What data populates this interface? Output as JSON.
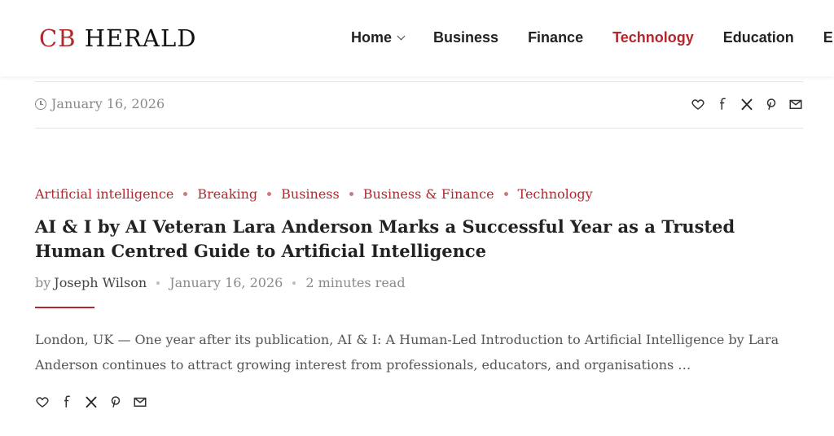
{
  "header": {
    "logo": {
      "prefix": "CB",
      "name": "HERALD"
    },
    "nav": [
      {
        "label": "Home",
        "has_dropdown": true,
        "active": false
      },
      {
        "label": "Business",
        "active": false
      },
      {
        "label": "Finance",
        "active": false
      },
      {
        "label": "Technology",
        "active": true
      },
      {
        "label": "Education",
        "active": false
      },
      {
        "label": "Ente",
        "active": false
      }
    ]
  },
  "top_meta": {
    "date": "January 16, 2026",
    "share_icons": [
      "heart-icon",
      "facebook-icon",
      "x-icon",
      "pinterest-icon",
      "mail-icon"
    ]
  },
  "article": {
    "categories": [
      "Artificial intelligence",
      "Breaking",
      "Business",
      "Business & Finance",
      "Technology"
    ],
    "title": "AI & I by AI Veteran Lara Anderson Marks a Successful Year as a Trusted Human Centred Guide to Artificial Intelligence",
    "by_prefix": "by",
    "author": "Joseph Wilson",
    "date": "January 16, 2026",
    "read_time": "2 minutes read",
    "excerpt": "London, UK — One year after its publication, AI & I: A Human-Led Introduction to Artificial Intelligence by Lara Anderson continues to attract growing interest from professionals, educators, and organisations …",
    "share_icons": [
      "heart-icon",
      "facebook-icon",
      "x-icon",
      "pinterest-icon",
      "mail-icon"
    ]
  },
  "colors": {
    "accent": "#b3282d",
    "text": "#222222",
    "muted": "#8a8a8a"
  }
}
